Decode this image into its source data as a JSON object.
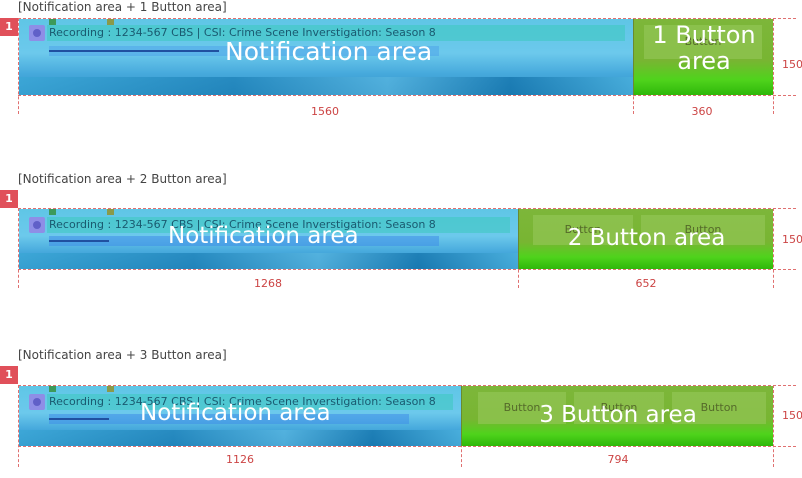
{
  "sections": [
    {
      "title": "[Notification area + 1 Button area]",
      "badge": "1",
      "recording_text": "Recording : 1234-567 CBS | CSI: Crime Scene Inverstigation: Season 8",
      "notification_label": "Notification area",
      "button_area_label": "1 Button area",
      "buttons": [
        "Button"
      ],
      "width_left": "1560",
      "width_right": "360",
      "height": "150"
    },
    {
      "title": "[Notification area + 2 Button area]",
      "badge": "1",
      "recording_text": "Recording : 1234-567 CBS | CSI: Crime Scene Inverstigation: Season 8",
      "notification_label": "Notification area",
      "button_area_label": "2 Button area",
      "buttons": [
        "Button",
        "Button"
      ],
      "width_left": "1268",
      "width_right": "652",
      "height": "150"
    },
    {
      "title": "[Notification area + 3 Button area]",
      "badge": "1",
      "recording_text": "Recording : 1234-567 CBS | CSI: Crime Scene Inverstigation: Season 8",
      "notification_label": "Notification area",
      "button_area_label": "3 Button area",
      "buttons": [
        "Button",
        "Button",
        "Button"
      ],
      "width_left": "1126",
      "width_right": "794",
      "height": "150"
    }
  ]
}
